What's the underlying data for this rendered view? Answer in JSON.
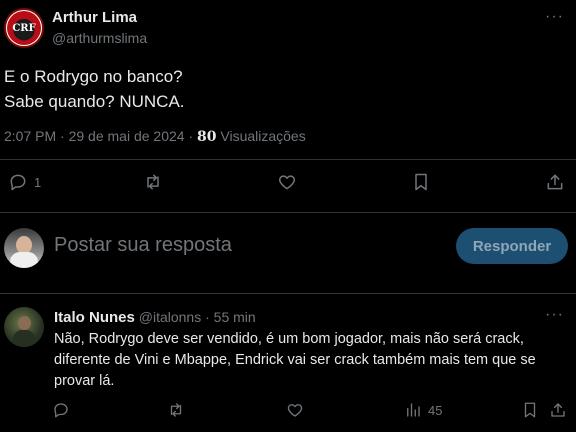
{
  "tweet": {
    "author_name": "Arthur Lima",
    "author_handle": "@arthurmslima",
    "avatar_initials": "CRF",
    "text_line1": "E o Rodrygo no banco?",
    "text_line2": "Sabe quando? NUNCA.",
    "timestamp": "2:07 PM · 29 de mai de 2024 · ",
    "views_count": "80",
    "views_label": " Visualizações",
    "more_glyph": "···",
    "actions": {
      "reply_count": "1",
      "retweet_count": "",
      "like_count": ""
    }
  },
  "reply_box": {
    "placeholder": "Postar sua resposta",
    "button_label": "Responder"
  },
  "comment": {
    "author_name": "Italo Nunes",
    "author_handle": "@italonns",
    "time_sep": " · ",
    "time": "55 min",
    "more_glyph": "···",
    "text": "Não, Rodrygo deve ser vendido, é um bom jogador, mais não será crack, diferente de Vini e Mbappe, Endrick vai ser crack também  mais tem que se provar lá.",
    "views_count": "45"
  },
  "colors": {
    "background": "#000000",
    "text_primary": "#e7e9ea",
    "text_secondary": "#71767b",
    "reply_button_bg": "#1d4f72",
    "separator": "#2f3336"
  },
  "icons": [
    "reply-icon",
    "retweet-icon",
    "like-icon",
    "bookmark-icon",
    "share-icon",
    "views-icon",
    "more-icon"
  ]
}
